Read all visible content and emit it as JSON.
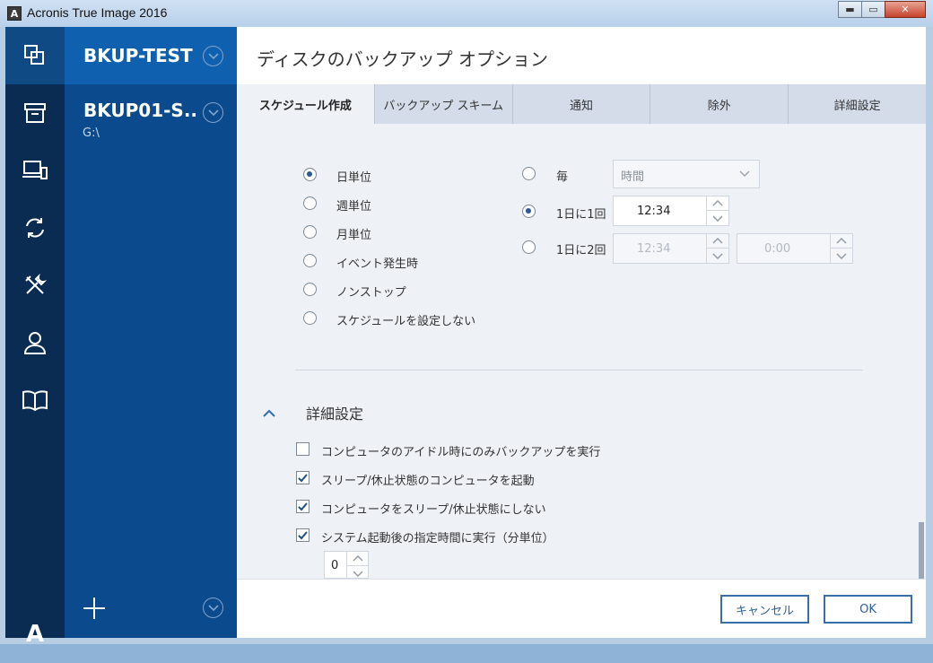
{
  "window": {
    "title": "Acronis True Image 2016",
    "app_icon_letter": "A",
    "min_glyph": "▬",
    "max_glyph": "▭",
    "close_glyph": "✕"
  },
  "nav": {
    "items": [
      "copy-icon",
      "archive-icon",
      "devices-icon",
      "sync-icon",
      "tools-icon",
      "account-icon",
      "book-icon"
    ],
    "logo": "A"
  },
  "backups": {
    "items": [
      {
        "name": "BKUP-TEST",
        "sub": ""
      },
      {
        "name": "BKUP01-S..",
        "sub": "G:\\"
      }
    ]
  },
  "header": {
    "title": "ディスクのバックアップ オプション"
  },
  "tabs": [
    {
      "label": "スケジュール作成"
    },
    {
      "label": "バックアップ スキーム"
    },
    {
      "label": "通知"
    },
    {
      "label": "除外"
    },
    {
      "label": "詳細設定"
    }
  ],
  "schedule": {
    "modes": [
      {
        "label": "日単位",
        "selected": true
      },
      {
        "label": "週単位",
        "selected": false
      },
      {
        "label": "月単位",
        "selected": false
      },
      {
        "label": "イベント発生時",
        "selected": false
      },
      {
        "label": "ノンストップ",
        "selected": false
      },
      {
        "label": "スケジュールを設定しない",
        "selected": false
      }
    ],
    "every_label": "毎",
    "every_unit": "時間",
    "once_label": "1日に1回",
    "once_time": "12:34",
    "twice_label": "1日に2回",
    "twice_time1": "12:34",
    "twice_time2": "0:00"
  },
  "advanced": {
    "title": "詳細設定",
    "options": [
      {
        "label": "コンピュータのアイドル時にのみバックアップを実行",
        "checked": false
      },
      {
        "label": "スリープ/休止状態のコンピュータを起動",
        "checked": true
      },
      {
        "label": "コンピュータをスリープ/休止状態にしない",
        "checked": true
      },
      {
        "label": "システム起動後の指定時間に実行（分単位）",
        "checked": true
      }
    ],
    "delay_minutes": "0"
  },
  "footer": {
    "cancel_label": "キャンセル",
    "ok_label": "OK"
  },
  "colors": {
    "nav_bg": "#0a2c52",
    "backup_bg": "#0b4a8c",
    "selected_bg": "#1060b0",
    "accent": "#3b6ea8"
  }
}
